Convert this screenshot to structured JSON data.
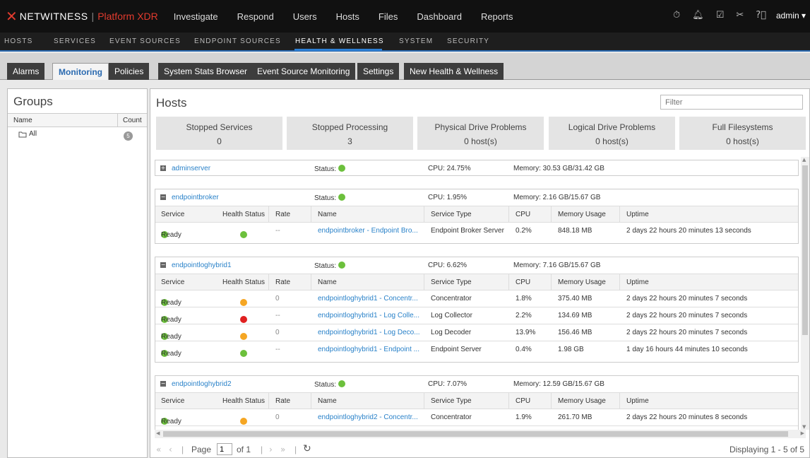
{
  "brand": {
    "name": "NETWITNESS",
    "product": "Platform XDR"
  },
  "topnav": [
    "Investigate",
    "Respond",
    "Users",
    "Hosts",
    "Files",
    "Dashboard",
    "Reports"
  ],
  "user": "admin",
  "secnav": [
    "HOSTS",
    "SERVICES",
    "EVENT SOURCES",
    "ENDPOINT SOURCES",
    "HEALTH & WELLNESS",
    "SYSTEM",
    "SECURITY"
  ],
  "tabs": [
    "Alarms",
    "Monitoring",
    "Policies",
    "System Stats Browser",
    "Event Source Monitoring",
    "Settings",
    "New Health & Wellness"
  ],
  "groups": {
    "title": "Groups",
    "col_name": "Name",
    "col_count": "Count",
    "item": "All",
    "count": "5"
  },
  "hosts": {
    "title": "Hosts",
    "filter_placeholder": "Filter",
    "tiles": [
      {
        "label": "Stopped Services",
        "value": "0"
      },
      {
        "label": "Stopped Processing",
        "value": "3"
      },
      {
        "label": "Physical Drive Problems",
        "value": "0 host(s)"
      },
      {
        "label": "Logical Drive Problems",
        "value": "0 host(s)"
      },
      {
        "label": "Full Filesystems",
        "value": "0 host(s)"
      }
    ],
    "status_label": "Status:",
    "columns": [
      "Service",
      "Health Status",
      "Rate",
      "Name",
      "Service Type",
      "CPU",
      "Memory Usage",
      "Uptime"
    ],
    "blocks": [
      {
        "name": "adminserver",
        "cpu": "CPU: 24.75%",
        "memory": "Memory: 30.53 GB/31.42 GB",
        "collapsed": true,
        "rows": []
      },
      {
        "name": "endpointbroker",
        "cpu": "CPU: 1.95%",
        "memory": "Memory: 2.16 GB/15.67 GB",
        "collapsed": false,
        "rows": [
          {
            "service": "Ready",
            "health": "g",
            "rate": "--",
            "name": "endpointbroker - Endpoint Bro...",
            "type": "Endpoint Broker Server",
            "cpu": "0.2%",
            "mem": "848.18 MB",
            "uptime": "2 days 22 hours 20 minutes 13 seconds"
          }
        ]
      },
      {
        "name": "endpointloghybrid1",
        "cpu": "CPU: 6.62%",
        "memory": "Memory: 7.16 GB/15.67 GB",
        "collapsed": false,
        "rows": [
          {
            "service": "Ready",
            "health": "o",
            "rate": "0",
            "name": "endpointloghybrid1 - Concentr...",
            "type": "Concentrator",
            "cpu": "1.8%",
            "mem": "375.40 MB",
            "uptime": "2 days 22 hours 20 minutes 7 seconds"
          },
          {
            "service": "Ready",
            "health": "r",
            "rate": "--",
            "name": "endpointloghybrid1 - Log Colle...",
            "type": "Log Collector",
            "cpu": "2.2%",
            "mem": "134.69 MB",
            "uptime": "2 days 22 hours 20 minutes 7 seconds"
          },
          {
            "service": "Ready",
            "health": "o",
            "rate": "0",
            "name": "endpointloghybrid1 - Log Deco...",
            "type": "Log Decoder",
            "cpu": "13.9%",
            "mem": "156.46 MB",
            "uptime": "2 days 22 hours 20 minutes 7 seconds"
          },
          {
            "service": "Ready",
            "health": "g",
            "rate": "--",
            "name": "endpointloghybrid1 - Endpoint ...",
            "type": "Endpoint Server",
            "cpu": "0.4%",
            "mem": "1.98 GB",
            "uptime": "1 day 16 hours 44 minutes 10 seconds"
          }
        ]
      },
      {
        "name": "endpointloghybrid2",
        "cpu": "CPU: 7.07%",
        "memory": "Memory: 12.59 GB/15.67 GB",
        "collapsed": false,
        "rows": [
          {
            "service": "Ready",
            "health": "o",
            "rate": "0",
            "name": "endpointloghybrid2 - Concentr...",
            "type": "Concentrator",
            "cpu": "1.9%",
            "mem": "261.70 MB",
            "uptime": "2 days 22 hours 20 minutes 8 seconds"
          },
          {
            "service": "",
            "health": "r",
            "rate": "",
            "name": "",
            "type": "",
            "cpu": "",
            "mem": "",
            "uptime": ""
          }
        ]
      }
    ]
  },
  "pager": {
    "page_label": "Page",
    "page": "1",
    "of": "of 1",
    "display": "Displaying 1 - 5 of 5"
  }
}
